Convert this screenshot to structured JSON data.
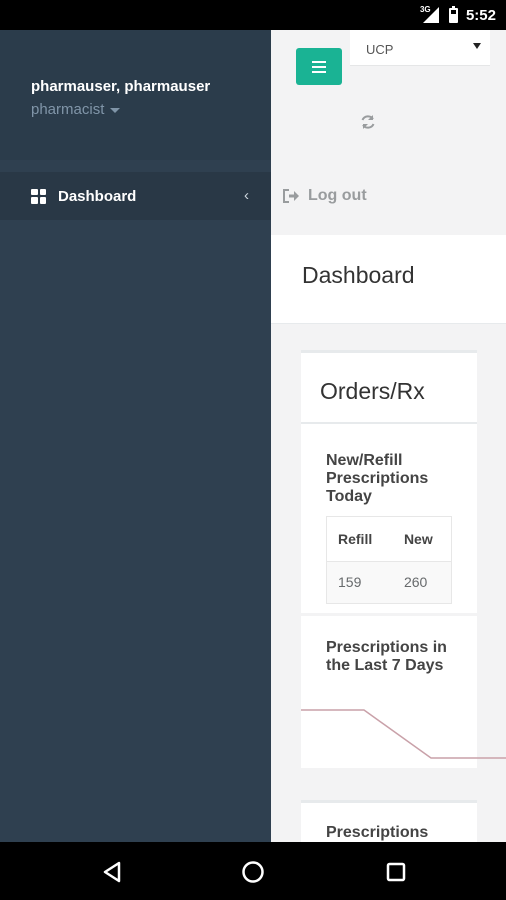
{
  "status_bar": {
    "time": "5:52",
    "network": "3G"
  },
  "sidebar": {
    "user_name": "pharmauser, pharmauser",
    "role": "pharmacist",
    "items": [
      {
        "label": "Dashboard",
        "icon": "grid-icon",
        "active": true
      }
    ]
  },
  "topbar": {
    "store_select": "UCP",
    "logout_label": "Log out"
  },
  "page": {
    "title": "Dashboard"
  },
  "orders_box": {
    "title": "Orders/Rx",
    "today_title": "New/Refill Prescriptions Today",
    "table": {
      "headers": [
        "Refill",
        "New"
      ],
      "rows": [
        [
          "159",
          "260"
        ]
      ]
    },
    "last7_title": "Prescriptions in the Last 7 Days",
    "chart_data": {
      "type": "line",
      "series": [
        {
          "values": [
            3,
            3,
            1,
            1
          ]
        }
      ]
    },
    "next_title": "Prescriptions"
  },
  "colors": {
    "sidebar_bg": "#2f4050",
    "accent": "#1ab394",
    "chart_line": "#c9a1a9"
  }
}
